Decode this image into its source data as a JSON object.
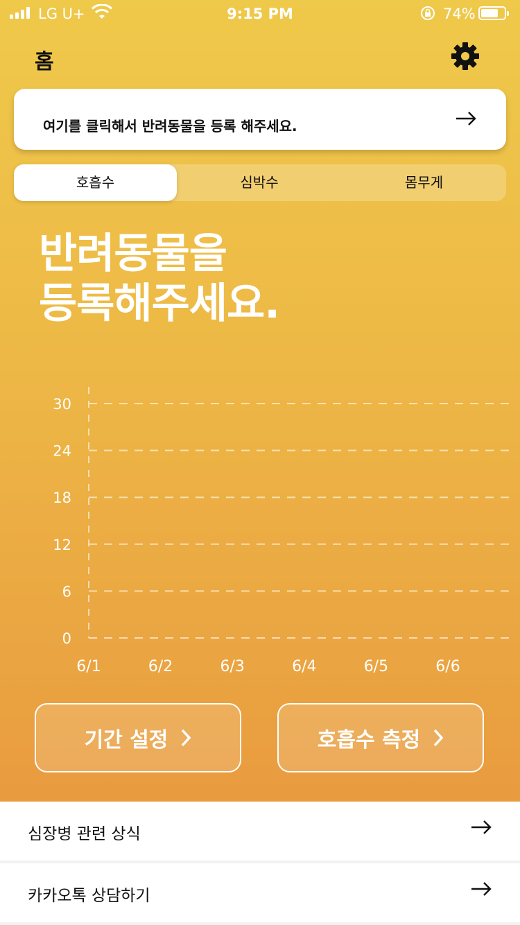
{
  "status_bar": {
    "carrier": "LG U+",
    "time": "9:15 PM",
    "battery": "74%"
  },
  "header": {
    "title": "홈"
  },
  "register_card": {
    "text": "여기를 클릭해서 반려동물을 등록 해주세요."
  },
  "tabs": [
    {
      "label": "호흡수",
      "active": true
    },
    {
      "label": "심박수",
      "active": false
    },
    {
      "label": "몸무게",
      "active": false
    }
  ],
  "headline": {
    "line1": "반려동물을",
    "line2": "등록해주세요."
  },
  "chart_data": {
    "type": "line",
    "categories": [
      "6/1",
      "6/2",
      "6/3",
      "6/4",
      "6/5",
      "6/6"
    ],
    "yticks": [
      "30",
      "24",
      "18",
      "12",
      "6",
      "0"
    ],
    "ylim": [
      0,
      30
    ],
    "series": [],
    "grid": true
  },
  "buttons": {
    "period": "기간 설정",
    "measure": "호흡수 측정"
  },
  "list": [
    {
      "label": "심장병 관련 상식"
    },
    {
      "label": "카카오톡 상담하기"
    }
  ],
  "colors": {
    "gradient_top": "#efc94a",
    "gradient_bottom": "#e99b3f"
  }
}
